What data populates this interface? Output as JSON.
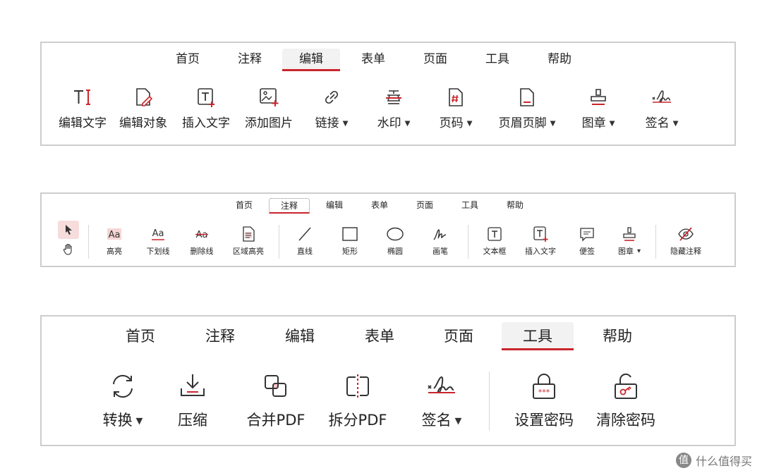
{
  "colors": {
    "accent": "#c9252c",
    "border": "#cdcdcd",
    "active_tab_bg": "#f2f2f2"
  },
  "panel_edit": {
    "tabs": [
      {
        "label": "首页"
      },
      {
        "label": "注释"
      },
      {
        "label": "编辑",
        "active": true
      },
      {
        "label": "表单"
      },
      {
        "label": "页面"
      },
      {
        "label": "工具"
      },
      {
        "label": "帮助"
      }
    ],
    "tools": [
      {
        "label": "编辑文字",
        "icon": "edit-text-icon"
      },
      {
        "label": "编辑对象",
        "icon": "edit-object-icon"
      },
      {
        "label": "插入文字",
        "icon": "insert-text-icon"
      },
      {
        "label": "添加图片",
        "icon": "add-image-icon"
      },
      {
        "label": "链接",
        "icon": "link-icon",
        "dropdown": true
      },
      {
        "label": "水印",
        "icon": "watermark-icon",
        "dropdown": true
      },
      {
        "label": "页码",
        "icon": "page-number-icon",
        "dropdown": true
      },
      {
        "label": "页眉页脚",
        "icon": "header-footer-icon",
        "dropdown": true
      },
      {
        "label": "图章",
        "icon": "stamp-icon",
        "dropdown": true
      },
      {
        "label": "签名",
        "icon": "signature-icon",
        "dropdown": true
      }
    ]
  },
  "panel_annot": {
    "tabs": [
      {
        "label": "首页"
      },
      {
        "label": "注释",
        "active": true
      },
      {
        "label": "编辑"
      },
      {
        "label": "表单"
      },
      {
        "label": "页面"
      },
      {
        "label": "工具"
      },
      {
        "label": "帮助"
      }
    ],
    "tools": [
      {
        "label": "高亮",
        "icon": "highlight-icon"
      },
      {
        "label": "下划线",
        "icon": "underline-icon"
      },
      {
        "label": "删除线",
        "icon": "strikethrough-icon"
      },
      {
        "label": "区域高亮",
        "icon": "area-highlight-icon"
      },
      {
        "label": "直线",
        "icon": "line-icon"
      },
      {
        "label": "矩形",
        "icon": "rectangle-icon"
      },
      {
        "label": "椭圆",
        "icon": "ellipse-icon"
      },
      {
        "label": "画笔",
        "icon": "pen-icon"
      },
      {
        "label": "文本框",
        "icon": "textbox-icon"
      },
      {
        "label": "插入文字",
        "icon": "insert-text-icon"
      },
      {
        "label": "便签",
        "icon": "sticky-note-icon"
      },
      {
        "label": "图章",
        "icon": "stamp-icon",
        "dropdown": true
      },
      {
        "label": "隐藏注释",
        "icon": "hide-annotation-icon"
      }
    ]
  },
  "panel_tools": {
    "tabs": [
      {
        "label": "首页"
      },
      {
        "label": "注释"
      },
      {
        "label": "编辑"
      },
      {
        "label": "表单"
      },
      {
        "label": "页面"
      },
      {
        "label": "工具",
        "active": true
      },
      {
        "label": "帮助"
      }
    ],
    "tools": [
      {
        "label": "转换",
        "icon": "convert-icon",
        "dropdown": true
      },
      {
        "label": "压缩",
        "icon": "compress-icon"
      },
      {
        "label": "合并PDF",
        "icon": "merge-pdf-icon"
      },
      {
        "label": "拆分PDF",
        "icon": "split-pdf-icon"
      },
      {
        "label": "签名",
        "icon": "signature-icon",
        "dropdown": true
      },
      {
        "label": "设置密码",
        "icon": "lock-password-icon"
      },
      {
        "label": "清除密码",
        "icon": "unlock-key-icon"
      }
    ]
  },
  "watermark": {
    "text": "什么值得买",
    "logo_glyph": "值"
  }
}
